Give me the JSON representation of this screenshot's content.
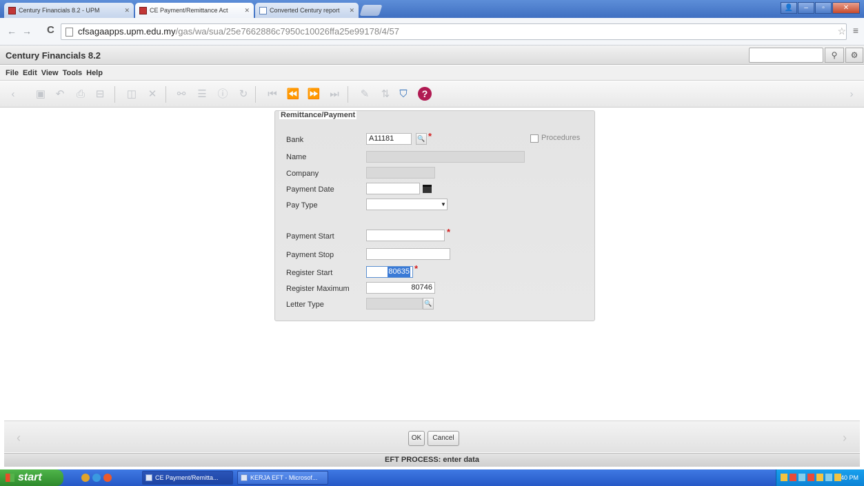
{
  "browser": {
    "tabs": [
      {
        "label": "Century Financials 8.2 - UPM",
        "active": false
      },
      {
        "label": "CE Payment/Remittance Act",
        "active": true
      },
      {
        "label": "Converted Century report",
        "active": false
      }
    ],
    "url_host": "cfsagaapps.upm.edu.my",
    "url_path": "/gas/wa/sua/25e7662886c7950c10026ffa25e99178/4/57"
  },
  "app": {
    "title": "Century Financials 8.2",
    "menu": [
      "File",
      "Edit",
      "View",
      "Tools",
      "Help"
    ]
  },
  "form": {
    "legend": "Remittance/Payment",
    "procedures_label": "Procedures",
    "fields": {
      "bank": {
        "label": "Bank",
        "value": "A11181"
      },
      "name": {
        "label": "Name",
        "value": ""
      },
      "company": {
        "label": "Company",
        "value": ""
      },
      "payment_date": {
        "label": "Payment Date",
        "value": ""
      },
      "pay_type": {
        "label": "Pay Type",
        "value": ""
      },
      "payment_start": {
        "label": "Payment Start",
        "value": ""
      },
      "payment_stop": {
        "label": "Payment Stop",
        "value": ""
      },
      "register_start": {
        "label": "Register Start",
        "value": "80635"
      },
      "register_maximum": {
        "label": "Register Maximum",
        "value": "80746"
      },
      "letter_type": {
        "label": "Letter Type",
        "value": ""
      }
    }
  },
  "buttons": {
    "ok": "OK",
    "cancel": "Cancel"
  },
  "status": "EFT PROCESS: enter data",
  "taskbar": {
    "start": "start",
    "tasks": [
      {
        "label": "CE Payment/Remitta..."
      },
      {
        "label": "KERJA EFT - Microsof..."
      }
    ],
    "clock": "2:40 PM"
  },
  "colors": {
    "accent": "#3a7ad6",
    "required": "#d21d1d",
    "help": "#b01a52"
  }
}
